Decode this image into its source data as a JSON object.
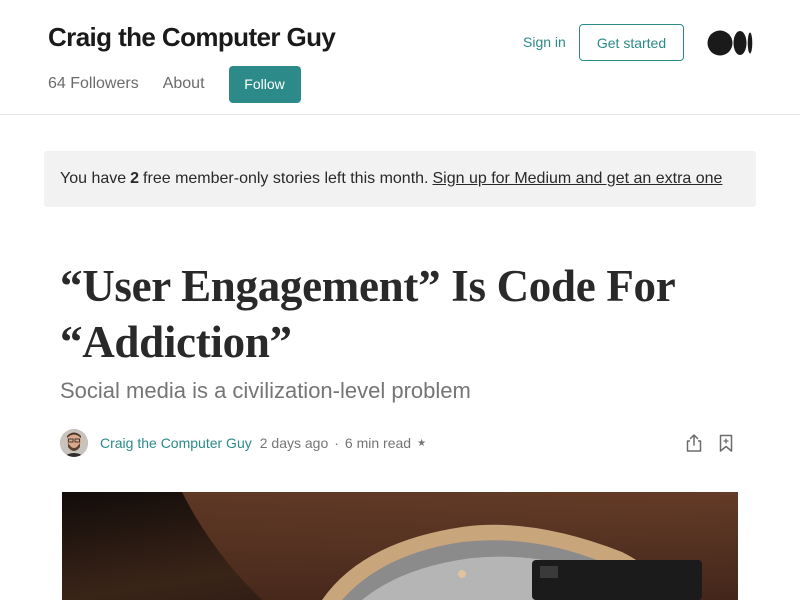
{
  "header": {
    "publication_title": "Craig the Computer Guy",
    "followers": "64 Followers",
    "about": "About",
    "follow_label": "Follow",
    "sign_in": "Sign in",
    "get_started": "Get started"
  },
  "banner": {
    "prefix": "You have",
    "count": "2",
    "suffix": "free member-only stories left this month.",
    "link": "Sign up for Medium and get an extra one"
  },
  "article": {
    "title": "“User Engagement” Is Code For “Addiction”",
    "subtitle": "Social media is a civilization-level problem",
    "author": "Craig the Computer Guy",
    "published": "2 days ago",
    "separator": "·",
    "read_time": "6 min read",
    "member_star": "★"
  },
  "colors": {
    "accent": "#2c8a89",
    "banner_bg": "#f2f2f2",
    "text": "#292929",
    "muted": "#757575"
  },
  "icons": [
    "medium-logo-icon",
    "share-icon",
    "bookmark-icon",
    "member-star-icon"
  ]
}
